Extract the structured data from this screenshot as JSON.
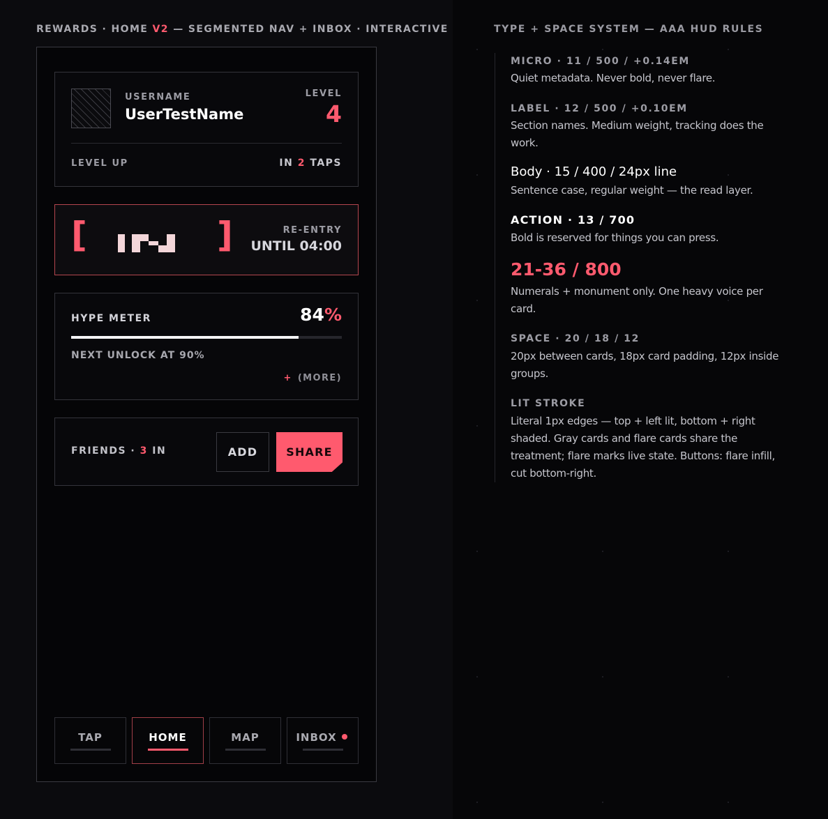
{
  "frame": {
    "title_prefix": "REWARDS · HOME ",
    "title_accent": "V2",
    "title_suffix": " — SEGMENTED NAV + INBOX · INTERACTIVE"
  },
  "profile": {
    "username_label": "USERNAME",
    "username": "UserTestName",
    "level_label": "LEVEL",
    "level": "4",
    "level_up_label": "LEVEL UP",
    "level_up_prefix": "IN ",
    "level_up_count": "2",
    "level_up_suffix": " TAPS"
  },
  "reentry": {
    "bracket_left": "[",
    "bracket_right": "]",
    "label": "RE-ENTRY",
    "value": "UNTIL 04:00",
    "glyph_icon": "in-wordmark-icon"
  },
  "hype": {
    "label": "HYPE METER",
    "value": "84",
    "unit": "%",
    "progress": 0.84,
    "next_unlock": "NEXT UNLOCK AT 90%",
    "more_plus": "+",
    "more_label": "(MORE)"
  },
  "friends": {
    "label_prefix": "FRIENDS · ",
    "count": "3",
    "label_suffix": " IN",
    "add_label": "ADD",
    "share_label": "SHARE"
  },
  "nav": {
    "tabs": [
      {
        "label": "TAP"
      },
      {
        "label": "HOME"
      },
      {
        "label": "MAP"
      },
      {
        "label": "INBOX"
      }
    ],
    "active": "HOME"
  },
  "rules": {
    "title": "TYPE + SPACE SYSTEM — AAA HUD RULES",
    "micro": {
      "head": "MICRO · 11 / 500 / +0.14EM",
      "text": "Quiet metadata. Never bold, never flare."
    },
    "label": {
      "head": "LABEL · 12 / 500 / +0.10EM",
      "text": "Section names. Medium weight, tracking does the work."
    },
    "body": {
      "head": "Body · 15 / 400 / 24px line",
      "text": "Sentence case, regular weight — the read layer."
    },
    "action": {
      "head": "ACTION · 13 / 700",
      "text": "Bold is reserved for things you can press."
    },
    "numerals": {
      "head": "21-36 / 800",
      "text": "Numerals + monument only. One heavy voice per card."
    },
    "space": {
      "head": "SPACE · 20 / 18 / 12",
      "text": "20px between cards, 18px card padding, 12px inside groups."
    },
    "stroke": {
      "head": "LIT STROKE",
      "text": "Literal 1px edges — top + left lit, bottom + right shaded. Gray cards and flare cards share the treatment; flare marks live state. Buttons: flare infill, cut bottom-right."
    }
  },
  "colors": {
    "accent": "#ff5a6e",
    "background": "#07070a",
    "panel": "#0b0b0e"
  }
}
